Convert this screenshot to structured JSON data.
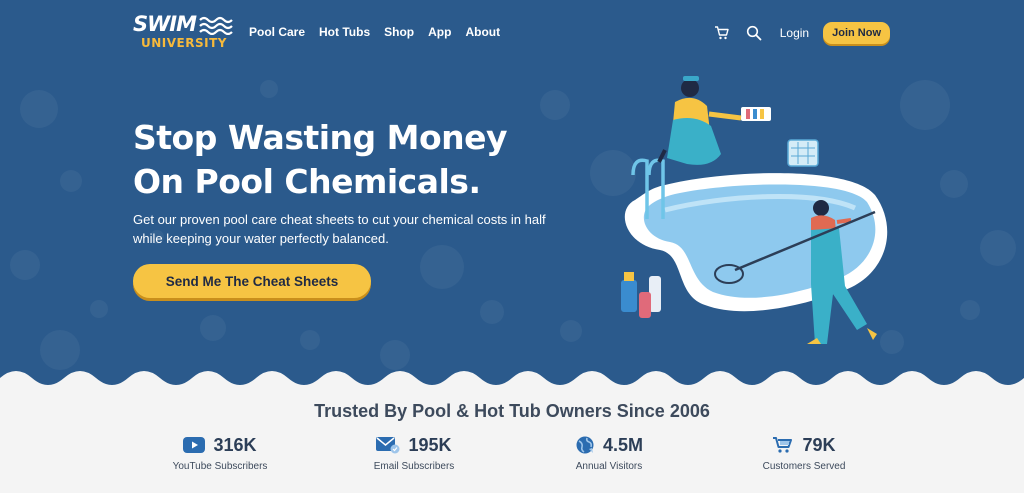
{
  "brand": {
    "logo_top": "SWIM",
    "logo_bottom": "UNIVERSITY"
  },
  "nav": {
    "links": [
      "Pool Care",
      "Hot Tubs",
      "Shop",
      "App",
      "About"
    ],
    "cart_icon": "cart-icon",
    "search_icon": "search-icon",
    "login": "Login",
    "join": "Join Now"
  },
  "hero": {
    "headline": "Stop Wasting Money On Pool Chemicals.",
    "subhead": "Get our proven pool care cheat sheets to cut your chemical costs in half while keeping your water perfectly balanced.",
    "cta": "Send Me The Cheat Sheets"
  },
  "trust": {
    "title": "Trusted By Pool & Hot Tub Owners Since 2006",
    "stats": [
      {
        "icon": "youtube-icon",
        "value": "316K",
        "label": "YouTube Subscribers"
      },
      {
        "icon": "email-icon",
        "value": "195K",
        "label": "Email Subscribers"
      },
      {
        "icon": "globe-icon",
        "value": "4.5M",
        "label": "Annual Visitors"
      },
      {
        "icon": "cart-icon",
        "value": "79K",
        "label": "Customers Served"
      }
    ]
  },
  "colors": {
    "hero_bg": "#2b5a8c",
    "accent": "#f6c443",
    "page_bg": "#f4f4f4",
    "icon_blue": "#2b6cb0"
  }
}
